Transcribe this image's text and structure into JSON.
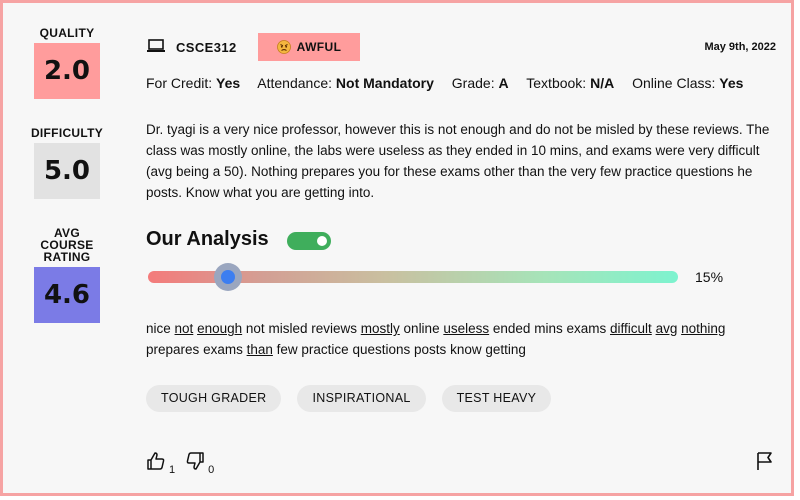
{
  "scores": {
    "quality": {
      "label": "QUALITY",
      "value": "2.0",
      "color": "#ff9c9c"
    },
    "difficulty": {
      "label": "DIFFICULTY",
      "value": "5.0",
      "color": "#e2e2e2"
    },
    "avg": {
      "label_lines": [
        "AVG",
        "COURSE",
        "RATING"
      ],
      "value": "4.6",
      "color": "#7b7be6"
    }
  },
  "header": {
    "course": "CSCE312",
    "rating_badge": "AWFUL",
    "rating_color": "#ff9c9c",
    "date": "May 9th, 2022",
    "icons": [
      "laptop-icon",
      "angry-face-icon"
    ]
  },
  "meta": [
    {
      "label": "For Credit:",
      "value": "Yes"
    },
    {
      "label": "Attendance:",
      "value": "Not Mandatory"
    },
    {
      "label": "Grade:",
      "value": "A"
    },
    {
      "label": "Textbook:",
      "value": "N/A"
    },
    {
      "label": "Online Class:",
      "value": "Yes"
    }
  ],
  "review": "Dr. tyagi is a very nice professor, however this is not enough and do not be misled by these reviews. The class was mostly online, the labs were useless as they ended in 10 mins, and exams were very difficult (avg being a 50). Nothing prepares you for these exams other than the very few practice questions he posts. Know what you are getting into.",
  "analysis": {
    "title": "Our Analysis",
    "toggle_on": true,
    "toggle_color": "#3fae5c",
    "sentiment_fraction": 0.15,
    "sentiment_label": "15%",
    "keywords": [
      {
        "w": "nice",
        "u": false
      },
      {
        "w": "not",
        "u": true
      },
      {
        "w": "enough",
        "u": true
      },
      {
        "w": "not",
        "u": false
      },
      {
        "w": "misled",
        "u": false
      },
      {
        "w": "reviews",
        "u": false
      },
      {
        "w": "mostly",
        "u": true
      },
      {
        "w": "online",
        "u": false
      },
      {
        "w": "useless",
        "u": true
      },
      {
        "w": "ended",
        "u": false
      },
      {
        "w": "mins",
        "u": false
      },
      {
        "w": "exams",
        "u": false
      },
      {
        "w": "difficult",
        "u": true
      },
      {
        "w": "avg",
        "u": true
      },
      {
        "w": "nothing",
        "u": true
      },
      {
        "w": "prepares",
        "u": false
      },
      {
        "w": "exams",
        "u": false
      },
      {
        "w": "than",
        "u": true
      },
      {
        "w": "few",
        "u": false
      },
      {
        "w": "practice",
        "u": false
      },
      {
        "w": "questions",
        "u": false
      },
      {
        "w": "posts",
        "u": false
      },
      {
        "w": "know",
        "u": false
      },
      {
        "w": "getting",
        "u": false
      }
    ]
  },
  "tags": [
    "TOUGH GRADER",
    "INSPIRATIONAL",
    "TEST HEAVY"
  ],
  "votes": {
    "up": "1",
    "down": "0",
    "icons": [
      "thumbs-up-icon",
      "thumbs-down-icon",
      "flag-icon"
    ]
  }
}
